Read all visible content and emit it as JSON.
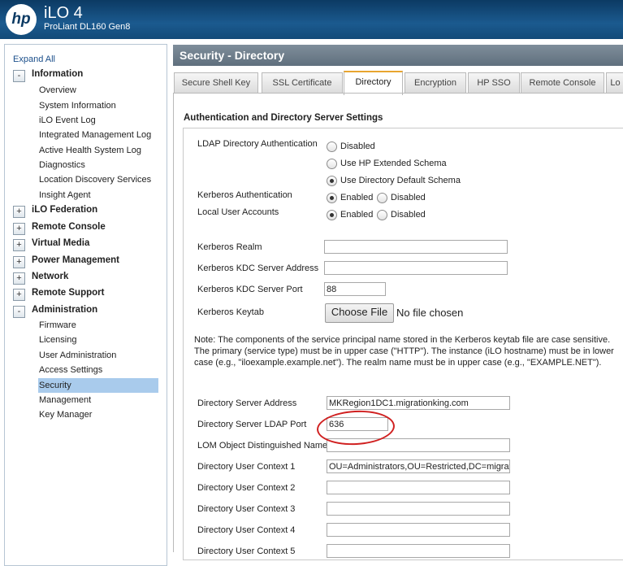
{
  "header": {
    "logo_text": "hp",
    "title": "iLO 4",
    "subtitle": "ProLiant DL160 Gen8"
  },
  "nav": {
    "expand_all": "Expand All",
    "groups": [
      {
        "toggle": "-",
        "label": "Information",
        "items": [
          "Overview",
          "System Information",
          "iLO Event Log",
          "Integrated Management Log",
          "Active Health System Log",
          "Diagnostics",
          "Location Discovery Services",
          "Insight Agent"
        ]
      },
      {
        "toggle": "+",
        "label": "iLO Federation"
      },
      {
        "toggle": "+",
        "label": "Remote Console"
      },
      {
        "toggle": "+",
        "label": "Virtual Media"
      },
      {
        "toggle": "+",
        "label": "Power Management"
      },
      {
        "toggle": "+",
        "label": "Network"
      },
      {
        "toggle": "+",
        "label": "Remote Support"
      },
      {
        "toggle": "-",
        "label": "Administration",
        "items": [
          "Firmware",
          "Licensing",
          "User Administration",
          "Access Settings",
          "Security",
          "Management",
          "Key Manager"
        ]
      }
    ],
    "selected_item": "Security"
  },
  "page": {
    "title": "Security - Directory"
  },
  "tabs": [
    "Secure Shell Key",
    "SSL Certificate",
    "Directory",
    "Encryption",
    "HP SSO",
    "Remote Console",
    "Lo"
  ],
  "active_tab": "Directory",
  "section": {
    "heading": "Authentication and Directory Server Settings"
  },
  "form": {
    "ldap_label": "LDAP Directory Authentication",
    "ldap_options": [
      "Disabled",
      "Use HP Extended Schema",
      "Use Directory Default Schema"
    ],
    "ldap_selected": "Use Directory Default Schema",
    "kerberos_auth_label": "Kerberos Authentication",
    "kerberos_auth_options": [
      "Enabled",
      "Disabled"
    ],
    "kerberos_auth_selected": "Enabled",
    "local_accounts_label": "Local User Accounts",
    "local_accounts_options": [
      "Enabled",
      "Disabled"
    ],
    "local_accounts_selected": "Enabled",
    "kerberos_realm_label": "Kerberos Realm",
    "kerberos_realm_value": "",
    "kdc_address_label": "Kerberos KDC Server Address",
    "kdc_address_value": "",
    "kdc_port_label": "Kerberos KDC Server Port",
    "kdc_port_value": "88",
    "keytab_label": "Kerberos Keytab",
    "choose_file_label": "Choose File",
    "no_file_text": "No file chosen",
    "note": "Note: The components of the service principal name stored in the Kerberos keytab file are case sensitive. The primary (service type) must be in upper case (\"HTTP\"). The instance (iLO hostname) must be in lower case (e.g., \"iloexample.example.net\"). The realm name must be in upper case (e.g., \"EXAMPLE.NET\").",
    "dir_address_label": "Directory Server Address",
    "dir_address_value": "MKRegion1DC1.migrationking.com",
    "dir_port_label": "Directory Server LDAP Port",
    "dir_port_value": "636",
    "lom_dn_label": "LOM Object Distinguished Name",
    "lom_dn_value": "",
    "context1_label": "Directory User Context 1",
    "context1_value": "OU=Administrators,OU=Restricted,DC=migratio",
    "context2_label": "Directory User Context 2",
    "context2_value": "",
    "context3_label": "Directory User Context 3",
    "context3_value": "",
    "context4_label": "Directory User Context 4",
    "context4_value": "",
    "context5_label": "Directory User Context 5",
    "context5_value": ""
  },
  "colors": {
    "header": "#1b5a8f",
    "selection": "#a9cbec",
    "active_tab_accent": "#e8a530",
    "annotation": "#d02020"
  }
}
